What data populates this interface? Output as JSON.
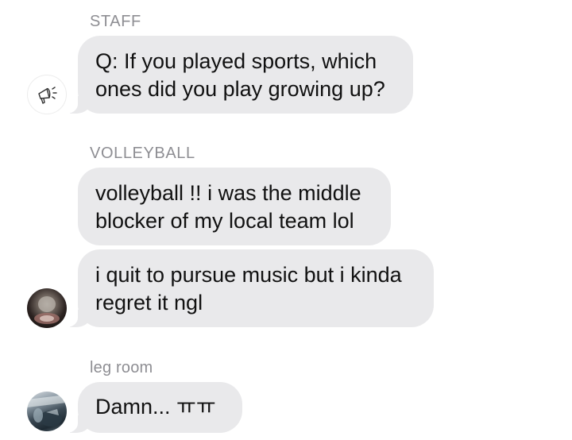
{
  "messages": [
    {
      "sender": "STAFF",
      "bubbles": [
        "Q: If you played sports, which\nones did you play growing up?"
      ],
      "avatar_icon": "megaphone-icon"
    },
    {
      "sender": "VOLLEYBALL",
      "bubbles": [
        "volleyball !! i was the middle\nblocker of my local team lol",
        "i quit to pursue music but i kinda\nregret it ngl"
      ],
      "avatar_icon": "profile-photo"
    },
    {
      "sender": "leg room",
      "bubbles": [
        "Damn... ㅠㅠ"
      ],
      "avatar_icon": "profile-photo"
    }
  ],
  "colors": {
    "bubble_bg": "#e9e9eb",
    "sender_text": "#8e8e93",
    "message_text": "#111111",
    "background": "#ffffff"
  }
}
